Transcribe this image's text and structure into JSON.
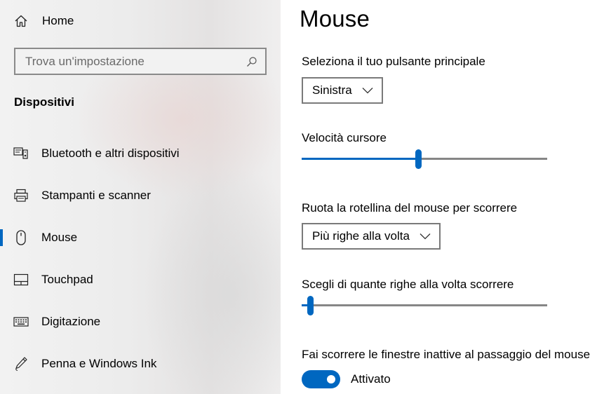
{
  "sidebar": {
    "home_label": "Home",
    "home_icon": "home-icon",
    "search_placeholder": "Trova un'impostazione",
    "search_icon": "search-icon",
    "section_title": "Dispositivi",
    "items": [
      {
        "label": "Bluetooth e altri dispositivi",
        "icon": "bluetooth-devices-icon",
        "selected": false
      },
      {
        "label": "Stampanti e scanner",
        "icon": "printer-icon",
        "selected": false
      },
      {
        "label": "Mouse",
        "icon": "mouse-icon",
        "selected": true
      },
      {
        "label": "Touchpad",
        "icon": "touchpad-icon",
        "selected": false
      },
      {
        "label": "Digitazione",
        "icon": "keyboard-icon",
        "selected": false
      },
      {
        "label": "Penna e Windows Ink",
        "icon": "pen-icon",
        "selected": false
      }
    ]
  },
  "main": {
    "title": "Mouse",
    "primary_button": {
      "label": "Seleziona il tuo pulsante principale",
      "value": "Sinistra"
    },
    "cursor_speed": {
      "label": "Velocità cursore",
      "fraction": 0.475
    },
    "wheel_scroll": {
      "label": "Ruota la rotellina del mouse per scorrere",
      "value": "Più righe alla volta"
    },
    "lines_to_scroll": {
      "label": "Scegli di quante righe alla volta scorrere",
      "fraction": 0.035
    },
    "inactive_scroll": {
      "label": "Fai scorrere le finestre inattive al passaggio del mouse",
      "state": "Attivato",
      "on": true
    }
  },
  "colors": {
    "accent": "#0067c0",
    "track": "#868686"
  }
}
